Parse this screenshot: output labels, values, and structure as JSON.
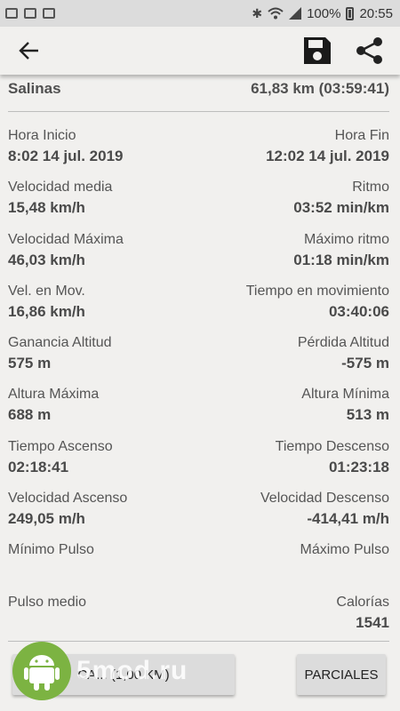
{
  "status_bar": {
    "battery_percent": "100%",
    "time": "20:55",
    "left_icons": [
      "mail-icon",
      "bag-icon",
      "image-icon"
    ],
    "right_icons": [
      "bluetooth-icon",
      "wifi-icon",
      "signal-icon",
      "battery-icon"
    ]
  },
  "toolbar": {
    "back_icon": "back-arrow-icon",
    "save_icon": "save-icon",
    "share_icon": "share-icon"
  },
  "summary": {
    "route_name": "Salinas",
    "distance_time": "61,83 km (03:59:41)"
  },
  "stats": [
    {
      "left_label": "Hora Inicio",
      "left_value": "8:02 14 jul. 2019",
      "right_label": "Hora Fin",
      "right_value": "12:02 14 jul. 2019"
    },
    {
      "left_label": "Velocidad media",
      "left_value": "15,48 km/h",
      "right_label": "Ritmo",
      "right_value": "03:52 min/km"
    },
    {
      "left_label": "Velocidad Máxima",
      "left_value": "46,03 km/h",
      "right_label": "Máximo ritmo",
      "right_value": "01:18 min/km"
    },
    {
      "left_label": "Vel. en Mov.",
      "left_value": "16,86 km/h",
      "right_label": "Tiempo en movimiento",
      "right_value": "03:40:06"
    },
    {
      "left_label": "Ganancia Altitud",
      "left_value": "575 m",
      "right_label": "Pérdida Altitud",
      "right_value": "-575 m"
    },
    {
      "left_label": "Altura Máxima",
      "left_value": "688 m",
      "right_label": "Altura Mínima",
      "right_value": "513 m"
    },
    {
      "left_label": "Tiempo Ascenso",
      "left_value": "02:18:41",
      "right_label": "Tiempo Descenso",
      "right_value": "01:23:18"
    },
    {
      "left_label": "Velocidad Ascenso",
      "left_value": "249,05 m/h",
      "right_label": "Velocidad Descenso",
      "right_value": "-414,41 m/h"
    },
    {
      "left_label": "Mínimo Pulso",
      "left_value": "",
      "right_label": "Máximo Pulso",
      "right_value": ""
    },
    {
      "left_label": "Pulso medio",
      "left_value": "",
      "right_label": "Calorías",
      "right_value": "1541"
    }
  ],
  "buttons": {
    "left_label": "CA... (1,00 KM)",
    "parciales_label": "PARCIALES"
  },
  "watermark": "5mod.ru"
}
